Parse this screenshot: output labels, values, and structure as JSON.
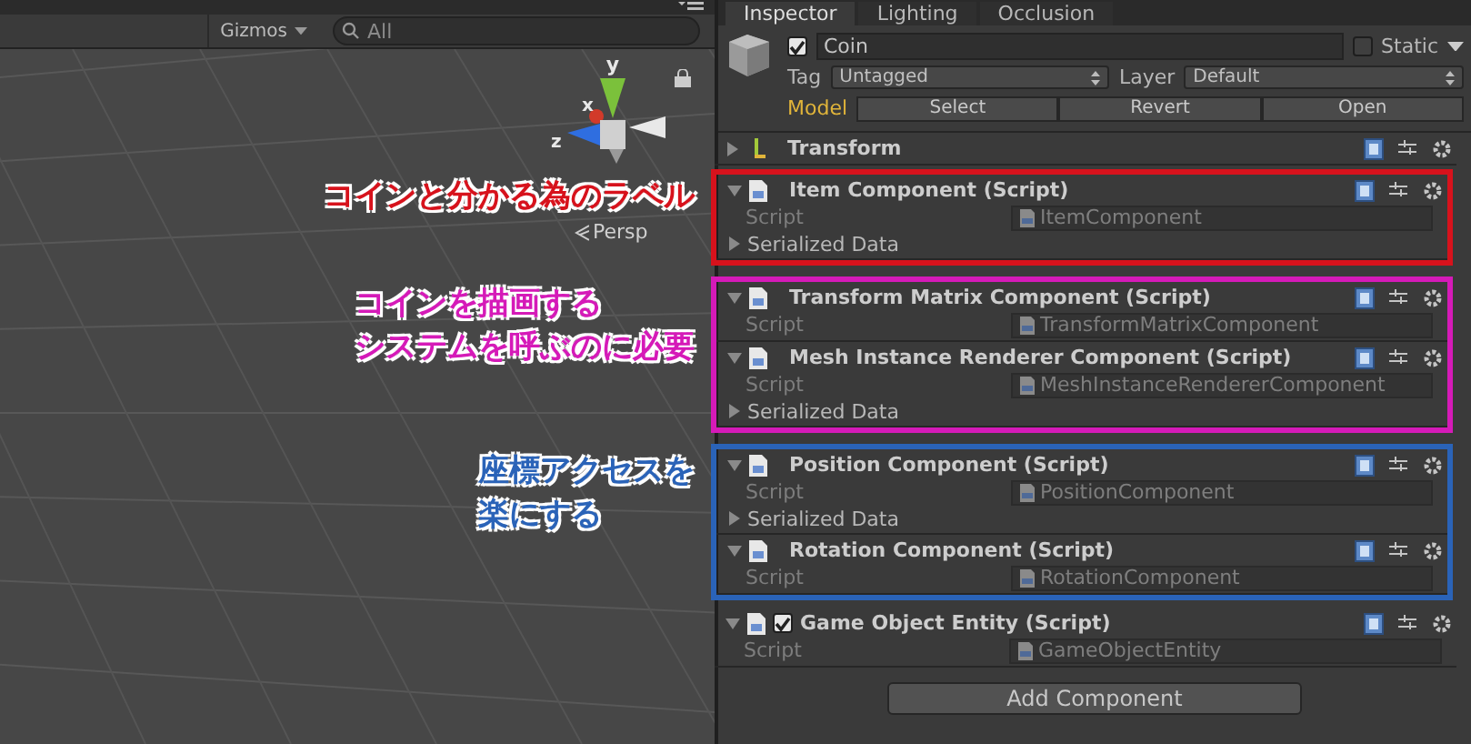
{
  "scene": {
    "gizmos": "Gizmos",
    "search": {
      "placeholder": "All"
    },
    "axis_labels": {
      "y": "y",
      "x": "x",
      "z": "z"
    },
    "view_label": "Persp"
  },
  "inspector": {
    "tabs": [
      {
        "label": "Inspector",
        "selected": true
      },
      {
        "label": "Lighting",
        "selected": false
      },
      {
        "label": "Occlusion",
        "selected": false
      }
    ],
    "object": {
      "active": true,
      "name": "Coin",
      "static": false,
      "static_label": "Static",
      "tag_label": "Tag",
      "tag": "Untagged",
      "layer_label": "Layer",
      "layer": "Default",
      "model_label": "Model",
      "model_buttons": [
        "Select",
        "Revert",
        "Open"
      ]
    },
    "sections": [
      {
        "components": [
          {
            "kind": "transform",
            "title": "Transform",
            "expanded": false
          }
        ]
      },
      {
        "annotation": {
          "lines": [
            "コインと分かる為のラベル"
          ],
          "color": "#d7121c"
        },
        "components": [
          {
            "kind": "script",
            "title": "Item Component (Script)",
            "expanded": true,
            "script_label": "Script",
            "script": "ItemComponent",
            "serialized_data": "Serialized Data"
          }
        ]
      },
      {
        "annotation": {
          "lines": [
            "コインを描画する",
            "システムを呼ぶのに必要"
          ],
          "color": "#d51ab8"
        },
        "components": [
          {
            "kind": "script",
            "title": "Transform Matrix Component (Script)",
            "expanded": true,
            "script_label": "Script",
            "script": "TransformMatrixComponent"
          },
          {
            "kind": "script",
            "title": "Mesh Instance Renderer Component (Script)",
            "expanded": true,
            "script_label": "Script",
            "script": "MeshInstanceRendererComponent",
            "serialized_data": "Serialized Data"
          }
        ]
      },
      {
        "annotation": {
          "lines": [
            "座標アクセスを",
            "楽にする"
          ],
          "color": "#2a63b8"
        },
        "components": [
          {
            "kind": "script",
            "title": "Position Component (Script)",
            "expanded": true,
            "script_label": "Script",
            "script": "PositionComponent",
            "serialized_data": "Serialized Data"
          },
          {
            "kind": "script",
            "title": "Rotation Component (Script)",
            "expanded": true,
            "script_label": "Script",
            "script": "RotationComponent"
          }
        ]
      },
      {
        "components": [
          {
            "kind": "script",
            "title": "Game Object Entity (Script)",
            "expanded": true,
            "enabled": true,
            "script_label": "Script",
            "script": "GameObjectEntity"
          }
        ]
      }
    ],
    "add_component": "Add Component"
  }
}
